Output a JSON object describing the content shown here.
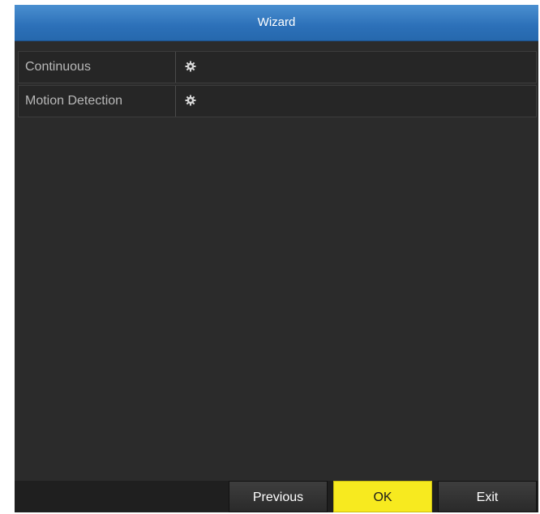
{
  "window": {
    "title": "Wizard"
  },
  "schedule": {
    "items": [
      {
        "label": "Continuous",
        "icon": "gear-icon"
      },
      {
        "label": "Motion Detection",
        "icon": "gear-icon"
      }
    ]
  },
  "footer": {
    "previous_label": "Previous",
    "ok_label": "OK",
    "exit_label": "Exit"
  },
  "colors": {
    "titlebar": "#2c70b8",
    "background": "#2b2b2b",
    "ok_button": "#f7ea1f",
    "text": "#b8b8b8"
  }
}
